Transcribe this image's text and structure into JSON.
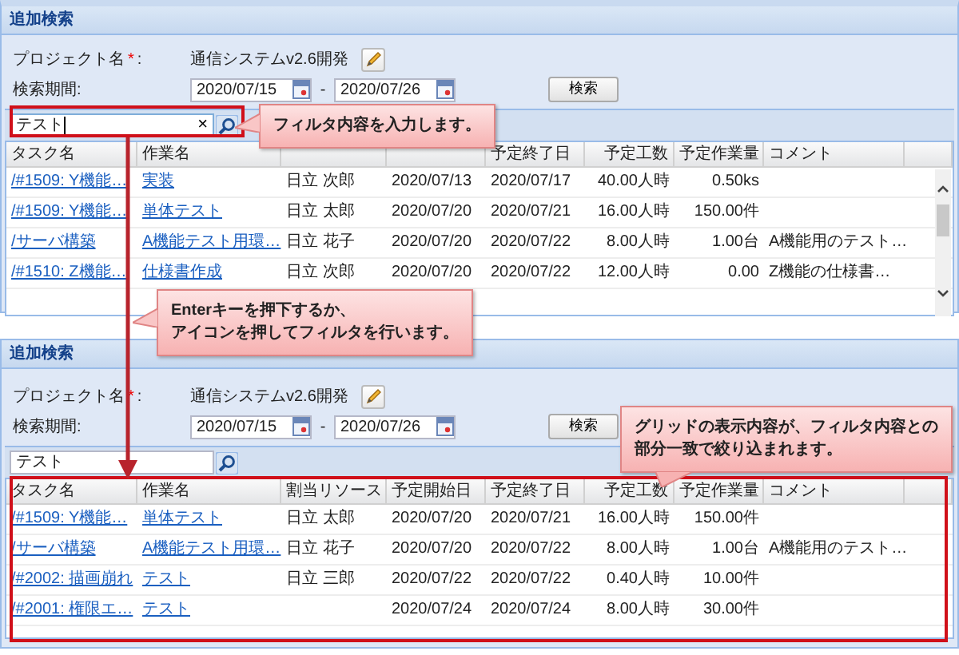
{
  "panels": [
    {
      "title": "追加検索",
      "project": {
        "label": "プロジェクト名",
        "required_mark": "*",
        "colon": ":",
        "value": "通信システムv2.6開発"
      },
      "period": {
        "label": "検索期間:",
        "from": "2020/07/15",
        "separator": "-",
        "to": "2020/07/26"
      },
      "search_button": "検索",
      "filter": {
        "value": "テスト",
        "focused": true,
        "clear": "×"
      },
      "columns": [
        "タスク名",
        "作業名",
        null,
        null,
        "予定終了日",
        "予定工数",
        "予定作業量",
        "コメント"
      ],
      "scrollbar": true,
      "rows": [
        {
          "cells": [
            "/#1509: Y機能…",
            "実装",
            "日立 次郎",
            "2020/07/13",
            "2020/07/17",
            "40.00人時",
            "0.50ks",
            null
          ]
        },
        {
          "cells": [
            "/#1509: Y機能…",
            "単体テスト",
            "日立 太郎",
            "2020/07/20",
            "2020/07/21",
            "16.00人時",
            "150.00件",
            null
          ]
        },
        {
          "cells": [
            "/サーバ構築",
            "A機能テスト用環…",
            "日立 花子",
            "2020/07/20",
            "2020/07/22",
            "8.00人時",
            "1.00台",
            "A機能用のテスト…"
          ]
        },
        {
          "cells": [
            "/#1510: Z機能…",
            "仕様書作成",
            "日立 次郎",
            "2020/07/20",
            "2020/07/22",
            "12.00人時",
            "0.00",
            "Z機能の仕様書…"
          ]
        }
      ]
    },
    {
      "title": "追加検索",
      "project": {
        "label": "プロジェクト名",
        "required_mark": "*",
        "colon": ":",
        "value": "通信システムv2.6開発"
      },
      "period": {
        "label": "検索期間:",
        "from": "2020/07/15",
        "separator": "-",
        "to": "2020/07/26"
      },
      "search_button": "検索",
      "filter": {
        "value": "テスト",
        "focused": false
      },
      "columns": [
        "タスク名",
        "作業名",
        "割当リソース",
        "予定開始日",
        "予定終了日",
        "予定工数",
        "予定作業量",
        "コメント"
      ],
      "scrollbar": false,
      "rows": [
        {
          "cells": [
            "/#1509: Y機能…",
            "単体テスト",
            "日立 太郎",
            "2020/07/20",
            "2020/07/21",
            "16.00人時",
            "150.00件",
            null
          ]
        },
        {
          "cells": [
            "/サーバ構築",
            "A機能テスト用環…",
            "日立 花子",
            "2020/07/20",
            "2020/07/22",
            "8.00人時",
            "1.00台",
            "A機能用のテスト…"
          ]
        },
        {
          "cells": [
            "/#2002: 描画崩れ",
            "テスト",
            "日立 三郎",
            "2020/07/22",
            "2020/07/22",
            "0.40人時",
            "10.00件",
            null
          ]
        },
        {
          "cells": [
            "/#2001: 権限エ…",
            "テスト",
            null,
            "2020/07/24",
            "2020/07/24",
            "8.00人時",
            "30.00件",
            null
          ]
        }
      ]
    }
  ],
  "callouts": [
    {
      "lines": [
        "フィルタ内容を入力します。"
      ]
    },
    {
      "lines": [
        "Enterキーを押下するか、",
        "アイコンを押してフィルタを行います。"
      ]
    },
    {
      "lines": [
        "グリッドの表示内容が、フィルタ内容との",
        "部分一致で絞り込まれます。"
      ]
    }
  ]
}
